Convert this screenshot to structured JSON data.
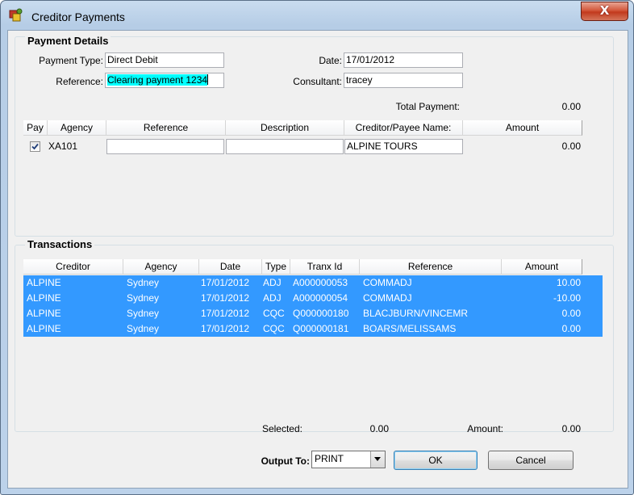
{
  "window": {
    "title": "Creditor Payments",
    "close_label": "X"
  },
  "payment_details": {
    "group_title": "Payment Details",
    "payment_type_label": "Payment Type:",
    "payment_type_value": "Direct Debit",
    "date_label": "Date:",
    "date_value": "17/01/2012",
    "reference_label": "Reference:",
    "reference_value": "Clearing payment 1234",
    "consultant_label": "Consultant:",
    "consultant_value": "tracey",
    "total_payment_label": "Total Payment:",
    "total_payment_value": "0.00",
    "columns": [
      "Pay",
      "Agency",
      "Reference",
      "Description",
      "Creditor/Payee Name:",
      "Amount"
    ],
    "row": {
      "pay_checked": true,
      "agency": "XA101",
      "reference": "",
      "description": "",
      "creditor_payee_name": "ALPINE TOURS",
      "amount": "0.00"
    }
  },
  "transactions": {
    "group_title": "Transactions",
    "columns": [
      "Creditor",
      "Agency",
      "Date",
      "Type",
      "Tranx Id",
      "Reference",
      "Amount"
    ],
    "rows": [
      [
        "ALPINE",
        "Sydney",
        "17/01/2012",
        "ADJ",
        "A000000053",
        "COMMADJ",
        "10.00"
      ],
      [
        "ALPINE",
        "Sydney",
        "17/01/2012",
        "ADJ",
        "A000000054",
        "COMMADJ",
        "-10.00"
      ],
      [
        "ALPINE",
        "Sydney",
        "17/01/2012",
        "CQC",
        "Q000000180",
        "BLACJBURN/VINCEMR",
        "0.00"
      ],
      [
        "ALPINE",
        "Sydney",
        "17/01/2012",
        "CQC",
        "Q000000181",
        "BOARS/MELISSAMS",
        "0.00"
      ]
    ],
    "selected_label": "Selected:",
    "selected_value": "0.00",
    "amount_label": "Amount:",
    "amount_value": "0.00"
  },
  "footer": {
    "output_to_label": "Output To:",
    "output_to_value": "PRINT",
    "ok_label": "OK",
    "cancel_label": "Cancel"
  },
  "colors": {
    "selection": "#3399ff",
    "reference_highlight": "#00ffff"
  },
  "icons": {
    "app": "creditor-app-icon",
    "close": "close-icon",
    "checkbox": "checkmark-icon",
    "dropdown": "chevron-down-icon"
  }
}
